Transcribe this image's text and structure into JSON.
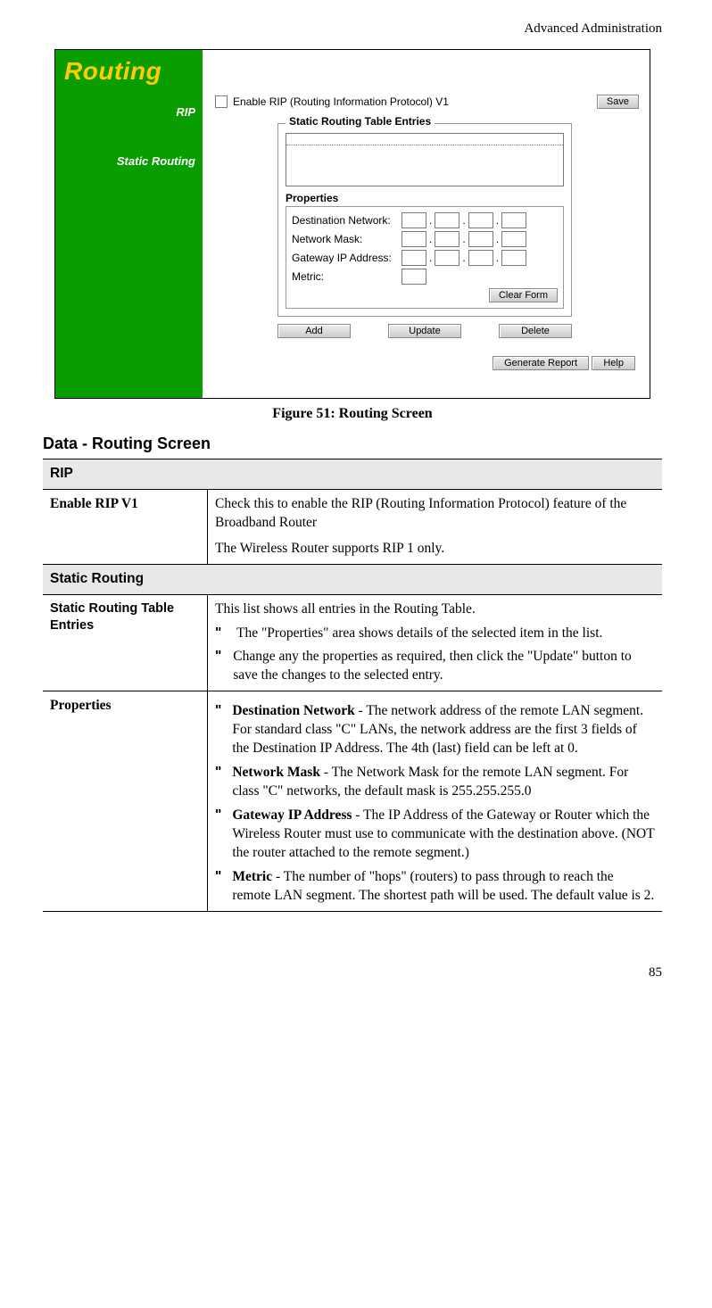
{
  "header": {
    "section": "Advanced Administration"
  },
  "screenshot": {
    "sidebar": {
      "title": "Routing",
      "rip_label": "RIP",
      "static_label": "Static Routing"
    },
    "rip": {
      "checkbox_label": "Enable RIP (Routing Information Protocol) V1",
      "save_btn": "Save"
    },
    "fieldset_legend": "Static Routing Table Entries",
    "properties_title": "Properties",
    "props": {
      "dest": "Destination Network:",
      "mask": "Network Mask:",
      "gw": "Gateway IP Address:",
      "metric": "Metric:"
    },
    "clear_btn": "Clear Form",
    "add_btn": "Add",
    "update_btn": "Update",
    "delete_btn": "Delete",
    "gen_btn": "Generate Report",
    "help_btn": "Help"
  },
  "figure_caption": "Figure 51: Routing Screen",
  "section_heading": "Data - Routing Screen",
  "table": {
    "cat_rip": "RIP",
    "enable_rip": {
      "label": "Enable RIP V1",
      "p1": "Check this to enable the RIP (Routing Information Protocol) feature of the Broadband Router",
      "p2": "The Wireless Router supports RIP 1 only."
    },
    "cat_static": "Static Routing",
    "entries": {
      "label": "Static Routing Table Entries",
      "intro": "This list shows all entries in the Routing Table.",
      "b1": "The \"Properties\" area shows details of the selected item in the list.",
      "b2": "Change any the properties as required, then click the \"Update\" button to save the changes to the selected entry."
    },
    "props": {
      "label": "Properties",
      "dest_b": "Destination Network",
      "dest_t": " - The network address of the remote LAN segment. For standard class \"C\" LANs, the network address are the first 3 fields of the Destination IP Address. The 4th (last) field can be left at 0.",
      "mask_b": "Network Mask",
      "mask_t": " - The Network Mask for the remote LAN segment. For class \"C\" networks, the default mask is 255.255.255.0",
      "gw_b": "Gateway IP Address",
      "gw_t": " - The IP Address of the Gateway or Router which the Wireless Router must use to communicate with the destination above. (NOT the router attached to the remote segment.)",
      "metric_b": "Metric",
      "metric_t": " - The number of \"hops\" (routers) to pass through to reach the remote LAN segment. The shortest path will be used. The default value is 2."
    }
  },
  "page_number": "85"
}
